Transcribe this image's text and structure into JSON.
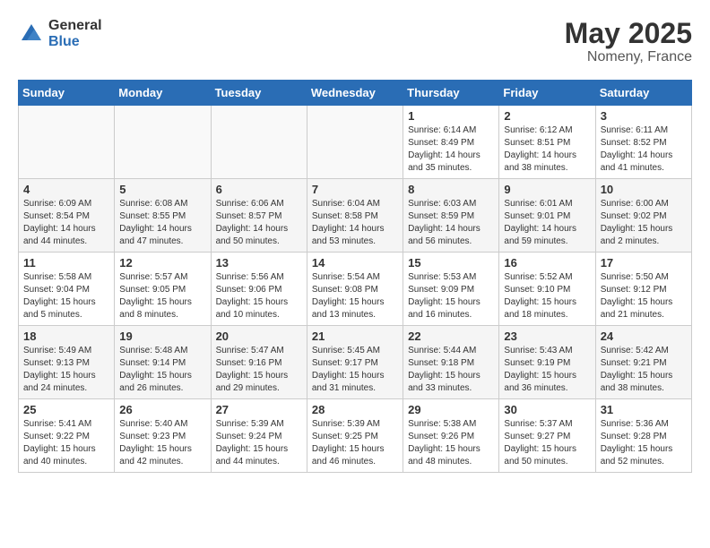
{
  "header": {
    "logo_general": "General",
    "logo_blue": "Blue",
    "month": "May 2025",
    "location": "Nomeny, France"
  },
  "weekdays": [
    "Sunday",
    "Monday",
    "Tuesday",
    "Wednesday",
    "Thursday",
    "Friday",
    "Saturday"
  ],
  "weeks": [
    [
      {
        "day": "",
        "info": ""
      },
      {
        "day": "",
        "info": ""
      },
      {
        "day": "",
        "info": ""
      },
      {
        "day": "",
        "info": ""
      },
      {
        "day": "1",
        "info": "Sunrise: 6:14 AM\nSunset: 8:49 PM\nDaylight: 14 hours\nand 35 minutes."
      },
      {
        "day": "2",
        "info": "Sunrise: 6:12 AM\nSunset: 8:51 PM\nDaylight: 14 hours\nand 38 minutes."
      },
      {
        "day": "3",
        "info": "Sunrise: 6:11 AM\nSunset: 8:52 PM\nDaylight: 14 hours\nand 41 minutes."
      }
    ],
    [
      {
        "day": "4",
        "info": "Sunrise: 6:09 AM\nSunset: 8:54 PM\nDaylight: 14 hours\nand 44 minutes."
      },
      {
        "day": "5",
        "info": "Sunrise: 6:08 AM\nSunset: 8:55 PM\nDaylight: 14 hours\nand 47 minutes."
      },
      {
        "day": "6",
        "info": "Sunrise: 6:06 AM\nSunset: 8:57 PM\nDaylight: 14 hours\nand 50 minutes."
      },
      {
        "day": "7",
        "info": "Sunrise: 6:04 AM\nSunset: 8:58 PM\nDaylight: 14 hours\nand 53 minutes."
      },
      {
        "day": "8",
        "info": "Sunrise: 6:03 AM\nSunset: 8:59 PM\nDaylight: 14 hours\nand 56 minutes."
      },
      {
        "day": "9",
        "info": "Sunrise: 6:01 AM\nSunset: 9:01 PM\nDaylight: 14 hours\nand 59 minutes."
      },
      {
        "day": "10",
        "info": "Sunrise: 6:00 AM\nSunset: 9:02 PM\nDaylight: 15 hours\nand 2 minutes."
      }
    ],
    [
      {
        "day": "11",
        "info": "Sunrise: 5:58 AM\nSunset: 9:04 PM\nDaylight: 15 hours\nand 5 minutes."
      },
      {
        "day": "12",
        "info": "Sunrise: 5:57 AM\nSunset: 9:05 PM\nDaylight: 15 hours\nand 8 minutes."
      },
      {
        "day": "13",
        "info": "Sunrise: 5:56 AM\nSunset: 9:06 PM\nDaylight: 15 hours\nand 10 minutes."
      },
      {
        "day": "14",
        "info": "Sunrise: 5:54 AM\nSunset: 9:08 PM\nDaylight: 15 hours\nand 13 minutes."
      },
      {
        "day": "15",
        "info": "Sunrise: 5:53 AM\nSunset: 9:09 PM\nDaylight: 15 hours\nand 16 minutes."
      },
      {
        "day": "16",
        "info": "Sunrise: 5:52 AM\nSunset: 9:10 PM\nDaylight: 15 hours\nand 18 minutes."
      },
      {
        "day": "17",
        "info": "Sunrise: 5:50 AM\nSunset: 9:12 PM\nDaylight: 15 hours\nand 21 minutes."
      }
    ],
    [
      {
        "day": "18",
        "info": "Sunrise: 5:49 AM\nSunset: 9:13 PM\nDaylight: 15 hours\nand 24 minutes."
      },
      {
        "day": "19",
        "info": "Sunrise: 5:48 AM\nSunset: 9:14 PM\nDaylight: 15 hours\nand 26 minutes."
      },
      {
        "day": "20",
        "info": "Sunrise: 5:47 AM\nSunset: 9:16 PM\nDaylight: 15 hours\nand 29 minutes."
      },
      {
        "day": "21",
        "info": "Sunrise: 5:45 AM\nSunset: 9:17 PM\nDaylight: 15 hours\nand 31 minutes."
      },
      {
        "day": "22",
        "info": "Sunrise: 5:44 AM\nSunset: 9:18 PM\nDaylight: 15 hours\nand 33 minutes."
      },
      {
        "day": "23",
        "info": "Sunrise: 5:43 AM\nSunset: 9:19 PM\nDaylight: 15 hours\nand 36 minutes."
      },
      {
        "day": "24",
        "info": "Sunrise: 5:42 AM\nSunset: 9:21 PM\nDaylight: 15 hours\nand 38 minutes."
      }
    ],
    [
      {
        "day": "25",
        "info": "Sunrise: 5:41 AM\nSunset: 9:22 PM\nDaylight: 15 hours\nand 40 minutes."
      },
      {
        "day": "26",
        "info": "Sunrise: 5:40 AM\nSunset: 9:23 PM\nDaylight: 15 hours\nand 42 minutes."
      },
      {
        "day": "27",
        "info": "Sunrise: 5:39 AM\nSunset: 9:24 PM\nDaylight: 15 hours\nand 44 minutes."
      },
      {
        "day": "28",
        "info": "Sunrise: 5:39 AM\nSunset: 9:25 PM\nDaylight: 15 hours\nand 46 minutes."
      },
      {
        "day": "29",
        "info": "Sunrise: 5:38 AM\nSunset: 9:26 PM\nDaylight: 15 hours\nand 48 minutes."
      },
      {
        "day": "30",
        "info": "Sunrise: 5:37 AM\nSunset: 9:27 PM\nDaylight: 15 hours\nand 50 minutes."
      },
      {
        "day": "31",
        "info": "Sunrise: 5:36 AM\nSunset: 9:28 PM\nDaylight: 15 hours\nand 52 minutes."
      }
    ]
  ]
}
